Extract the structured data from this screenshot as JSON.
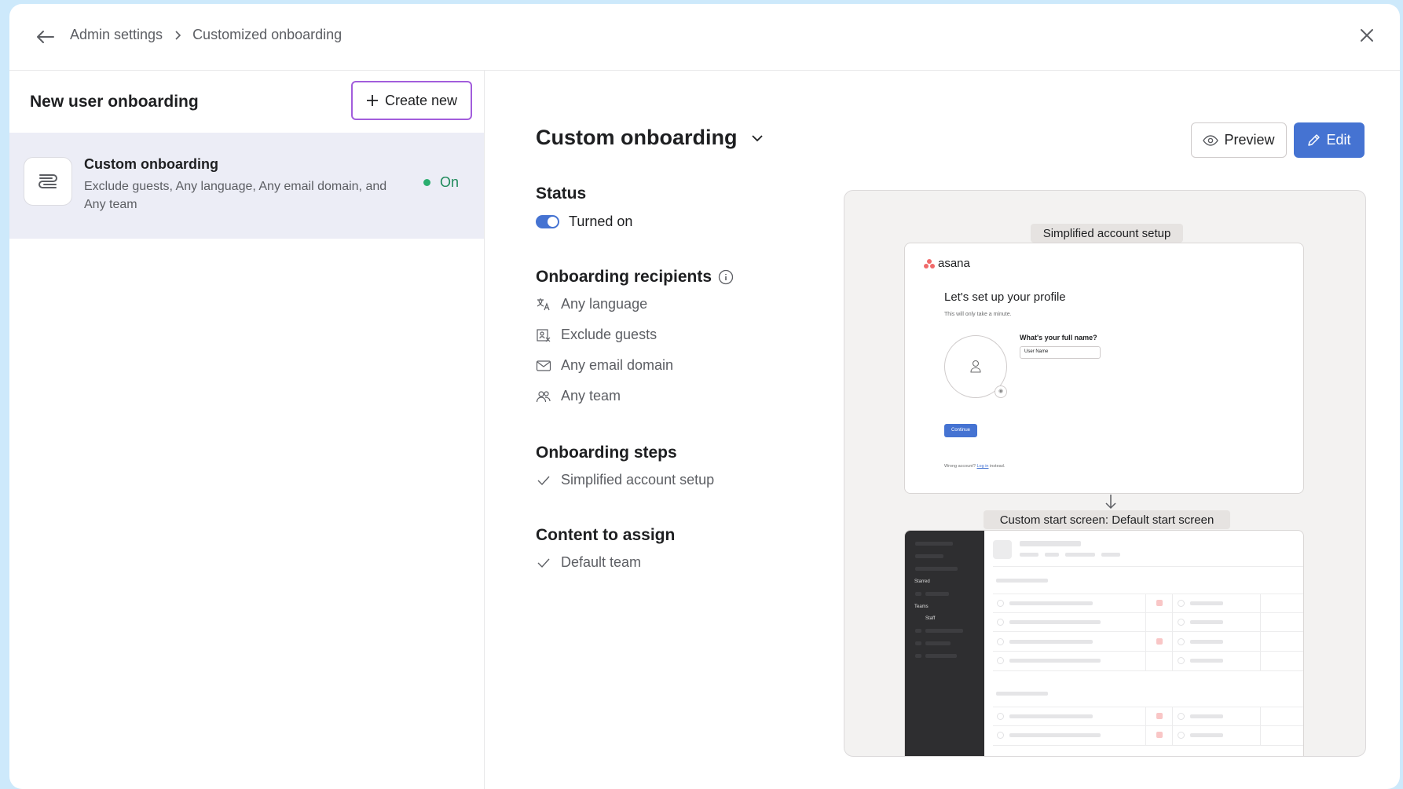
{
  "breadcrumb": {
    "parent": "Admin settings",
    "current": "Customized onboarding"
  },
  "left": {
    "title": "New user onboarding",
    "create_label": "Create new",
    "item": {
      "title": "Custom onboarding",
      "description": "Exclude guests, Any language, Any email domain, and Any team",
      "status": "On"
    }
  },
  "main": {
    "title": "Custom onboarding",
    "preview_label": "Preview",
    "edit_label": "Edit",
    "status_heading": "Status",
    "status_value": "Turned on",
    "recipients_heading": "Onboarding recipients",
    "recipients": [
      {
        "icon": "translate-icon",
        "label": "Any language"
      },
      {
        "icon": "guest-excluded-icon",
        "label": "Exclude guests"
      },
      {
        "icon": "mail-icon",
        "label": "Any email domain"
      },
      {
        "icon": "team-icon",
        "label": "Any team"
      }
    ],
    "steps_heading": "Onboarding steps",
    "steps": [
      "Simplified account setup"
    ],
    "content_heading": "Content to assign",
    "content": [
      "Default team"
    ]
  },
  "preview": {
    "step1_label": "Simplified account setup",
    "logo_text": "asana",
    "profile_title": "Let's set up your profile",
    "profile_subtitle": "This will only take a minute.",
    "name_question": "What's your full name?",
    "name_value": "User Name",
    "continue_label": "Continue",
    "wrong_account_prefix": "Wrong account?",
    "wrong_account_link": "Log in",
    "wrong_account_suffix": "instead.",
    "step2_label": "Custom start screen: Default start screen",
    "sidebar_starred": "Starred",
    "sidebar_teams": "Teams",
    "sidebar_team_name": "Staff"
  },
  "colors": {
    "accent": "#4573d2",
    "create_border": "#a25ddc",
    "status_green": "#2bae6f",
    "logo": "#f06a6a"
  }
}
